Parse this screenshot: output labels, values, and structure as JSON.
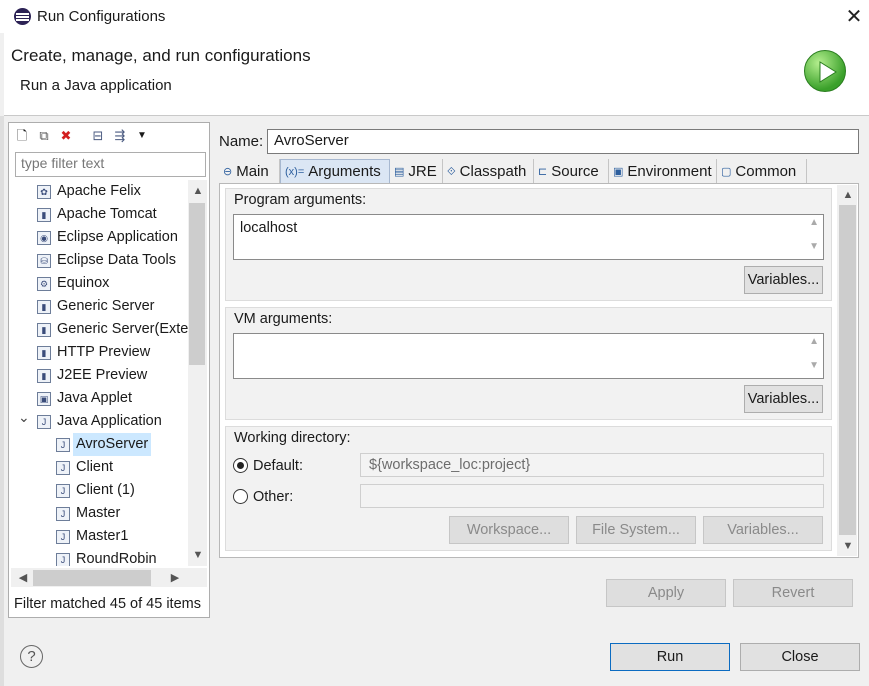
{
  "window": {
    "title": "Run Configurations",
    "close_glyph": "✕"
  },
  "header": {
    "title": "Create, manage, and run configurations",
    "subtitle": "Run a Java application",
    "logo_icon": "run-icon"
  },
  "left_panel": {
    "toolbar": [
      "new-configuration-icon",
      "duplicate-icon",
      "delete-icon",
      "collapse-all-icon",
      "filter-icon",
      "dropdown-icon"
    ],
    "filter_placeholder": "type filter text",
    "tree": [
      {
        "label": "Apache Felix",
        "icon": "felix-icon"
      },
      {
        "label": "Apache Tomcat",
        "icon": "server-icon"
      },
      {
        "label": "Eclipse Application",
        "icon": "eclipse-icon"
      },
      {
        "label": "Eclipse Data Tools",
        "icon": "database-icon"
      },
      {
        "label": "Equinox",
        "icon": "equinox-icon"
      },
      {
        "label": "Generic Server",
        "icon": "server-icon"
      },
      {
        "label": "Generic Server(Exte",
        "icon": "server-icon"
      },
      {
        "label": "HTTP Preview",
        "icon": "server-icon"
      },
      {
        "label": "J2EE Preview",
        "icon": "server-icon"
      },
      {
        "label": "Java Applet",
        "icon": "applet-icon"
      },
      {
        "label": "Java Application",
        "icon": "java-app-icon",
        "expanded": true
      },
      {
        "label": "AvroServer",
        "icon": "java-class-icon",
        "selected": true
      },
      {
        "label": "Client",
        "icon": "java-class-icon"
      },
      {
        "label": "Client (1)",
        "icon": "java-class-icon"
      },
      {
        "label": "Master",
        "icon": "java-class-icon"
      },
      {
        "label": "Master1",
        "icon": "java-class-icon"
      },
      {
        "label": "RoundRobin",
        "icon": "java-class-icon"
      }
    ],
    "filter_status": "Filter matched 45 of 45 items"
  },
  "config": {
    "name_label": "Name:",
    "name_value": "AvroServer",
    "tabs": [
      {
        "label": "Main",
        "icon": "main-icon",
        "glyph": "⊖"
      },
      {
        "label": "Arguments",
        "icon": "arguments-icon",
        "glyph": "(x)=",
        "active": true
      },
      {
        "label": "JRE",
        "icon": "jre-icon",
        "glyph": "▤"
      },
      {
        "label": "Classpath",
        "icon": "classpath-icon",
        "glyph": "⟐"
      },
      {
        "label": "Source",
        "icon": "source-icon",
        "glyph": "⊏"
      },
      {
        "label": "Environment",
        "icon": "environment-icon",
        "glyph": "▣"
      },
      {
        "label": "Common",
        "icon": "common-icon",
        "glyph": "▢"
      }
    ],
    "program_args_label": "Program arguments:",
    "program_args_value": "localhost",
    "variables_label": "Variables...",
    "vm_args_label": "VM arguments:",
    "vm_args_value": "",
    "working_dir_label": "Working directory:",
    "default_label": "Default:",
    "default_value": "${workspace_loc:project}",
    "other_label": "Other:",
    "other_value": "",
    "workspace_btn": "Workspace...",
    "filesystem_btn": "File System...",
    "wd_variables_btn": "Variables...",
    "apply_label": "Apply",
    "revert_label": "Revert"
  },
  "footer": {
    "help_glyph": "?",
    "run_label": "Run",
    "close_label": "Close"
  }
}
